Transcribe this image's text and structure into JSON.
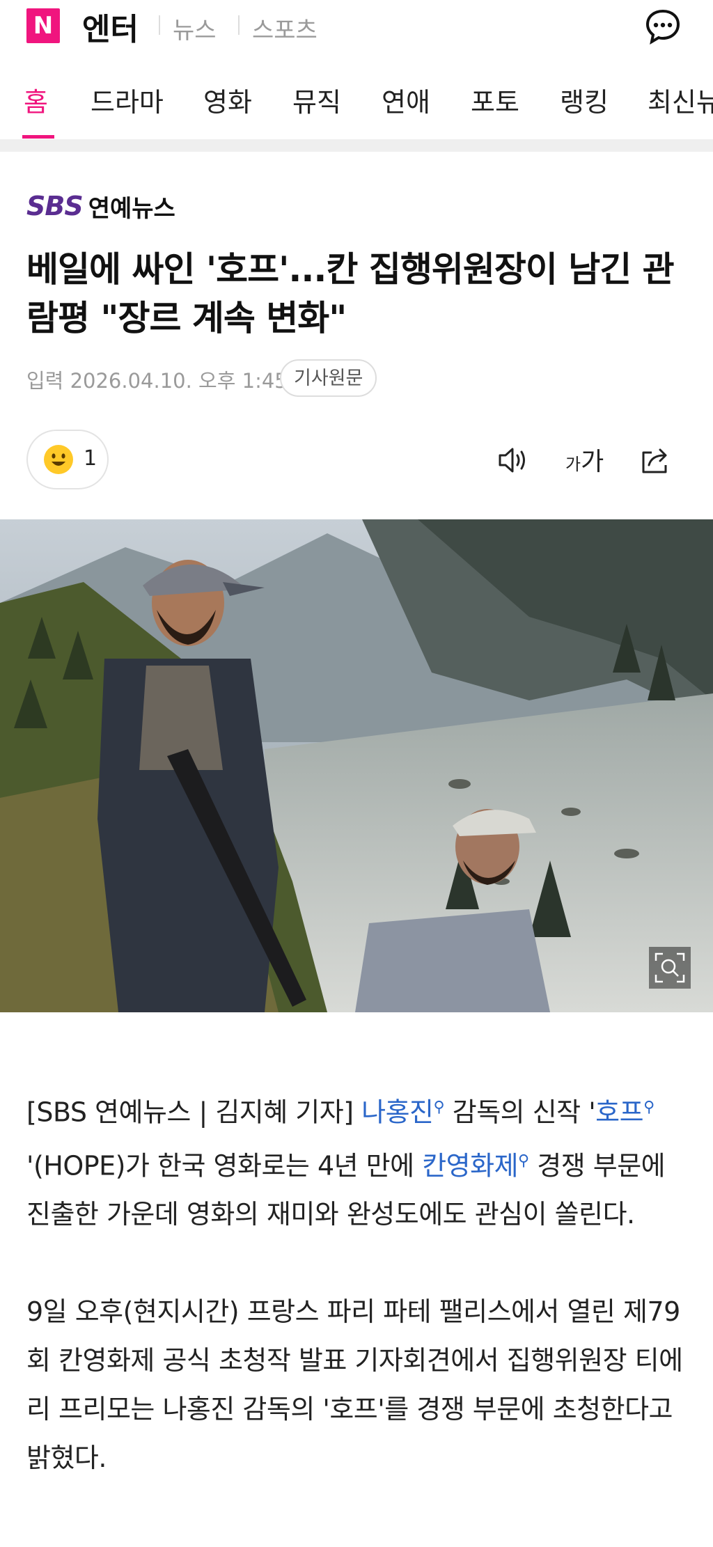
{
  "header": {
    "logo_letter": "N",
    "brand": "엔터",
    "nav": [
      "뉴스",
      "스포츠"
    ]
  },
  "tabs": [
    "홈",
    "드라마",
    "영화",
    "뮤직",
    "연애",
    "포토",
    "랭킹",
    "최신뉴"
  ],
  "press": {
    "sbs": "SBS",
    "name": "연예뉴스"
  },
  "article": {
    "headline": "베일에 싸인 '호프'...칸 집행위원장이 남긴 관람평 \"장르 계속 변화\"",
    "date": "입력 2026.04.10. 오후 1:45",
    "origin_button": "기사원문",
    "reaction_count": "1",
    "font_small": "가",
    "font_big": "가",
    "p1": {
      "a": "[SBS 연예뉴스 | 김지혜 기자] ",
      "link1": "나홍진",
      "b": "  감독의 신작 '",
      "link2": "호프",
      "c": " '(HOPE)가 한국 영화로는 4년 만에 ",
      "link3": "칸영화제",
      "d": "  경쟁 부문에 진출한 가운데 영화의 재미와 완성도에도 관심이 쏠린다."
    },
    "p2": "9일 오후(현지시간) 프랑스 파리 파테 팰리스에서 열린 제79회 칸영화제 공식 초청작 발표 기자회견에서 집행위원장 티에리 프리모는 나홍진 감독의 '호프'를 경쟁 부문에 초청한다고 밝혔다."
  },
  "colors": {
    "accent": "#f0157e",
    "link": "#2a66c9",
    "press": "#5a2d91"
  },
  "icons": {
    "chat": "chat-bubble-icon",
    "tts": "speaker-icon",
    "share": "share-icon",
    "zoom": "zoom-search-icon",
    "reaction": "smiley-icon",
    "link_search": "magnifier-icon"
  }
}
